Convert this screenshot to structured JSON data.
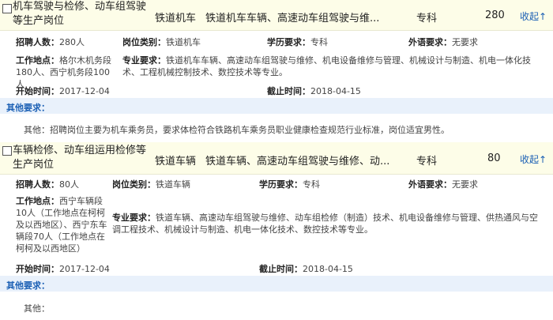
{
  "jobs": [
    {
      "title": "机车驾驶与检修、动车组驾驶等生产岗位",
      "unit": "铁道机车",
      "majors_short": "铁道机车车辆、高速动车组驾驶与维...",
      "education": "专科",
      "count": "280",
      "toggle": "收起↑",
      "recruit_label": "招聘人数：",
      "recruit_value": "280人",
      "category_label": "岗位类别：",
      "category_value": "铁道机车",
      "edu_label": "学历要求：",
      "edu_value": "专科",
      "lang_label": "外语要求：",
      "lang_value": "无要求",
      "location_label": "工作地点：",
      "location_value": "格尔木机务段180人、西宁机务段100人",
      "major_label": "专业要求：",
      "major_value": "铁道机车车辆、高速动车组驾驶与维修、机电设备维修与管理、机械设计与制造、机电一体化技术、工程机械控制技术、数控技术等专业。",
      "start_label": "开始时间：",
      "start_value": "2017-12-04",
      "end_label": "截止时间：",
      "end_value": "2018-04-15",
      "other_label": "其他要求：",
      "other_value": "其他：招聘岗位主要为机车乘务员，要求体检符合铁路机车乘务员职业健康检查规范行业标准，岗位适宜男性。"
    },
    {
      "title": "车辆检修、动车组运用检修等生产岗位",
      "unit": "铁道车辆",
      "majors_short": "铁道车辆、高速动车组驾驶与维修、动...",
      "education": "专科",
      "count": "80",
      "toggle": "收起↑",
      "recruit_label": "招聘人数：",
      "recruit_value": "80人",
      "category_label": "岗位类别：",
      "category_value": "铁道车辆",
      "edu_label": "学历要求：",
      "edu_value": "专科",
      "lang_label": "外语要求：",
      "lang_value": "无要求",
      "location_label": "工作地点：",
      "location_value": "西宁车辆段10人（工作地点在柯柯及以西地区）、西宁东车辆段70人（工作地点在柯柯及以西地区）",
      "major_label": "专业要求：",
      "major_value": "铁道车辆、高速动车组驾驶与维修、动车组检修（制造）技术、机电设备维修与管理、供热通风与空调工程技术、机械设计与制造、机电一体化技术、数控技术等专业。",
      "start_label": "开始时间：",
      "start_value": "2017-12-04",
      "end_label": "截止时间：",
      "end_value": "2018-04-15",
      "other_label": "其他要求：",
      "other_value": "其他："
    }
  ]
}
